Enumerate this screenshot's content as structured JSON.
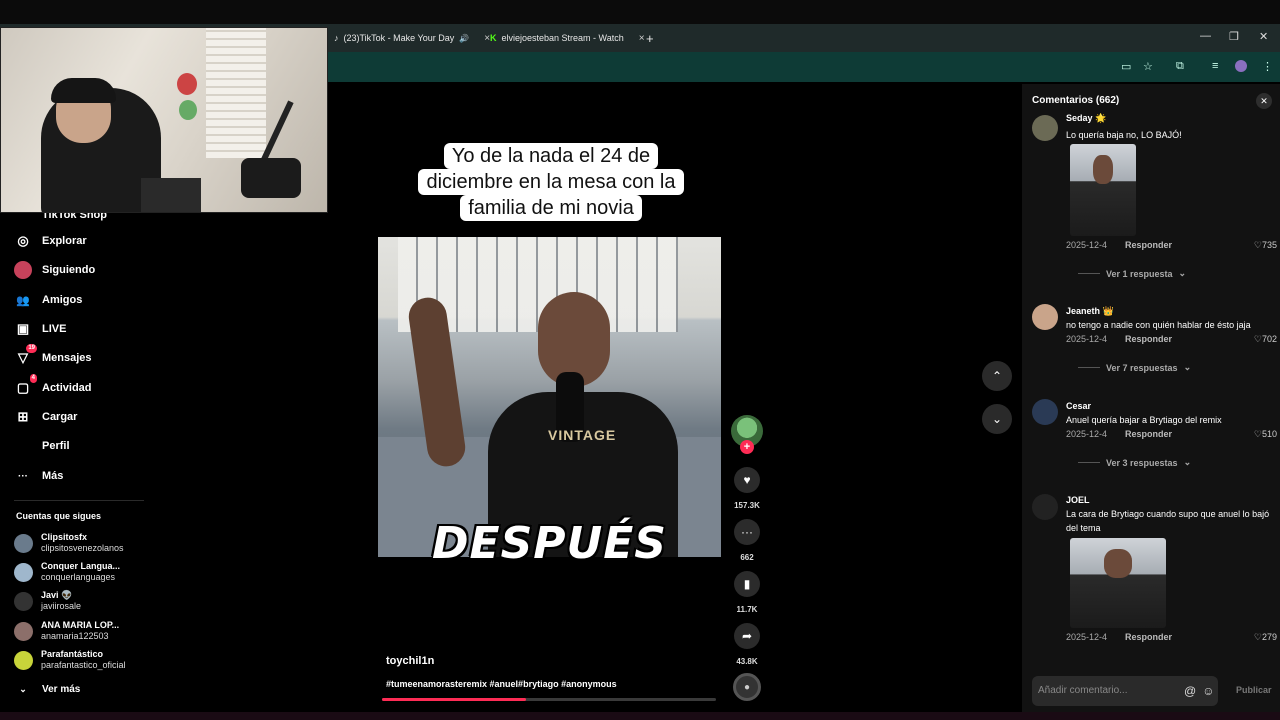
{
  "browser": {
    "tabs": [
      {
        "title": "(23)TikTok - Make Your Day",
        "close": "×"
      },
      {
        "title": "elviejoesteban Stream - Watch",
        "close": "×"
      }
    ],
    "new_tab": "+",
    "window_controls": {
      "minimize": "—",
      "restore": "❐",
      "close": "✕"
    }
  },
  "nav": {
    "items": [
      {
        "label": "TikTok Shop",
        "icon": "shop-icon",
        "glyph": "🛍"
      },
      {
        "label": "Explorar",
        "icon": "compass-icon",
        "glyph": "◎"
      },
      {
        "label": "Siguiendo",
        "icon": "following-icon",
        "glyph": "●"
      },
      {
        "label": "Amigos",
        "icon": "friends-icon",
        "glyph": "👥"
      },
      {
        "label": "LIVE",
        "icon": "live-icon",
        "glyph": "▣"
      },
      {
        "label": "Mensajes",
        "icon": "messages-icon",
        "glyph": "▽",
        "badge": "19"
      },
      {
        "label": "Actividad",
        "icon": "activity-icon",
        "glyph": "▢",
        "badge": "4"
      },
      {
        "label": "Cargar",
        "icon": "upload-icon",
        "glyph": "⊞"
      },
      {
        "label": "Perfil",
        "icon": "profile-icon",
        "glyph": ""
      },
      {
        "label": "Más",
        "icon": "more-icon",
        "glyph": "···"
      }
    ],
    "following_title": "Cuentas que sigues",
    "accounts": [
      {
        "name": "Clipsitosfx",
        "handle": "clipsitosvenezolanos",
        "color": "#6a7b8c"
      },
      {
        "name": "Conquer Langua...",
        "handle": "conquerlanguages",
        "color": "#9fb7cc"
      },
      {
        "name": "Javi 👽",
        "handle": "javiirosale",
        "color": "#222"
      },
      {
        "name": "ANA MARIA LOP...",
        "handle": "anamaria122503",
        "color": "#8c6f6a"
      },
      {
        "name": "Parafantástico",
        "handle": "parafantastico_oficial",
        "color": "#c8d43a"
      }
    ],
    "see_more": "Ver más"
  },
  "video": {
    "caption_lines": [
      "Yo de la nada el 24 de",
      "diciembre en la mesa con la",
      "familia de mi novia"
    ],
    "shirt_text": "VINTAGE",
    "overlay_text": "DESPUÉS",
    "author": "toychil1n",
    "hashtags": "#tumeenamorasteremix #anuel#brytiago #anonymous",
    "progress": 0.43
  },
  "actions": {
    "likes": "157.3K",
    "comments": "662",
    "saves": "11.7K",
    "shares": "43.8K"
  },
  "comments": {
    "title": "Comentarios (662)",
    "items": [
      {
        "name": "Seday 🌟",
        "text": "Lo quería baja no, LO BAJÓ!",
        "date": "2025-12-4",
        "reply": "Responder",
        "likes": "735",
        "more": "Ver 1 respuesta"
      },
      {
        "name": "Jeaneth 👑",
        "text": "no tengo a nadie con quién hablar de ésto jaja",
        "date": "2025-12-4",
        "reply": "Responder",
        "likes": "702",
        "more": "Ver 7 respuestas"
      },
      {
        "name": "Cesar",
        "text": "Anuel quería bajar a Brytiago del remix",
        "date": "2025-12-4",
        "reply": "Responder",
        "likes": "510",
        "more": "Ver 3 respuestas"
      },
      {
        "name": "JOEL",
        "text": "La cara de Brytiago cuando supo que anuel lo bajó del tema",
        "date": "2025-12-4",
        "reply": "Responder",
        "likes": "279"
      }
    ],
    "input_placeholder": "Añadir comentario...",
    "post_label": "Publicar"
  }
}
